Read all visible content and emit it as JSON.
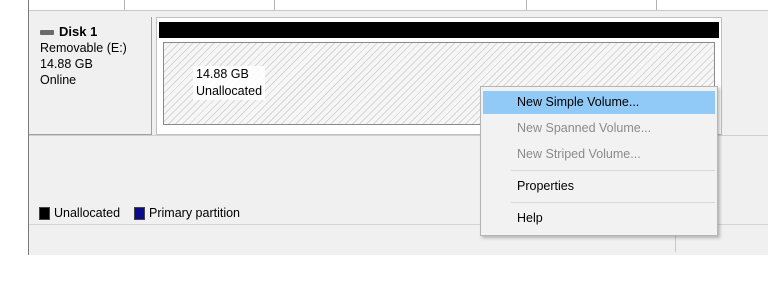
{
  "disk": {
    "name": "Disk 1",
    "type": "Removable (E:)",
    "size": "14.88 GB",
    "status": "Online"
  },
  "volume": {
    "size": "14.88 GB",
    "state": "Unallocated"
  },
  "legend": {
    "unallocated": "Unallocated",
    "primary": "Primary partition"
  },
  "context_menu": {
    "items": [
      {
        "label": "New Simple Volume...",
        "enabled": true,
        "highlighted": true
      },
      {
        "label": "New Spanned Volume...",
        "enabled": false
      },
      {
        "label": "New Striped Volume...",
        "enabled": false
      },
      {
        "label": "Properties",
        "enabled": true
      },
      {
        "label": "Help",
        "enabled": true
      }
    ]
  },
  "colors": {
    "unallocated": "#000000",
    "primary_partition": "#0a0a8c",
    "menu_highlight": "#91c9f7"
  }
}
